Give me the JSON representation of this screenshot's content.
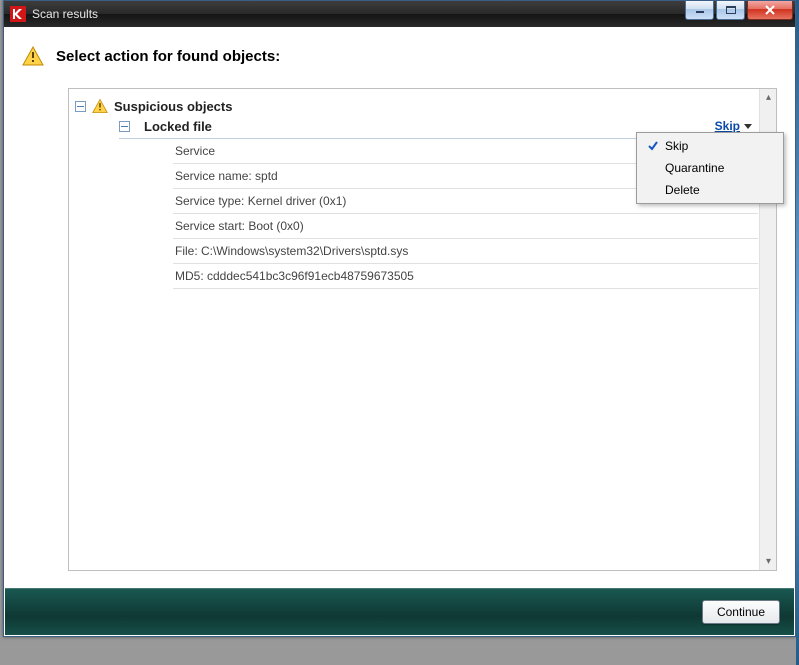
{
  "title": "Scan results",
  "heading": "Select action for found objects:",
  "category": {
    "label": "Suspicious objects"
  },
  "subcategory": {
    "label": "Locked file",
    "action_label": "Skip"
  },
  "details": [
    "Service",
    "Service name: sptd",
    "Service type: Kernel driver (0x1)",
    "Service start: Boot (0x0)",
    "File: C:\\Windows\\system32\\Drivers\\sptd.sys",
    "MD5: cdddec541bc3c96f91ecb48759673505"
  ],
  "dropdown": {
    "items": [
      "Skip",
      "Quarantine",
      "Delete"
    ],
    "selected": "Skip"
  },
  "footer": {
    "continue_label": "Continue"
  }
}
